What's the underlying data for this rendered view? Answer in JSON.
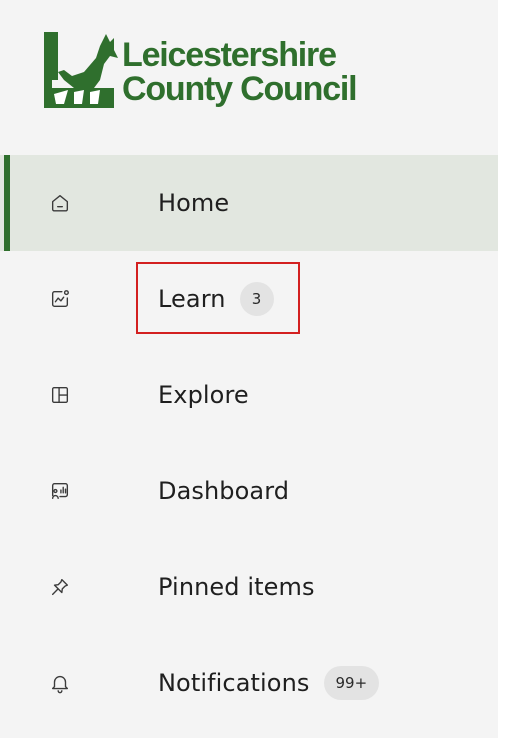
{
  "colors": {
    "brand": "#2f6f2d",
    "active_bg": "#e2e7e0",
    "badge_bg": "#e3e3e3",
    "highlight": "#d32020"
  },
  "logo": {
    "line1": "Leicestershire",
    "line2": "County Council",
    "icon": "fox-logo-icon"
  },
  "nav": {
    "items": [
      {
        "label": "Home",
        "icon": "home-icon",
        "active": true
      },
      {
        "label": "Learn",
        "icon": "learn-chart-icon",
        "badge": "3"
      },
      {
        "label": "Explore",
        "icon": "explore-grid-icon"
      },
      {
        "label": "Dashboard",
        "icon": "dashboard-icon"
      },
      {
        "label": "Pinned items",
        "icon": "pin-icon"
      },
      {
        "label": "Notifications",
        "icon": "bell-icon",
        "badge": "99+"
      }
    ]
  }
}
